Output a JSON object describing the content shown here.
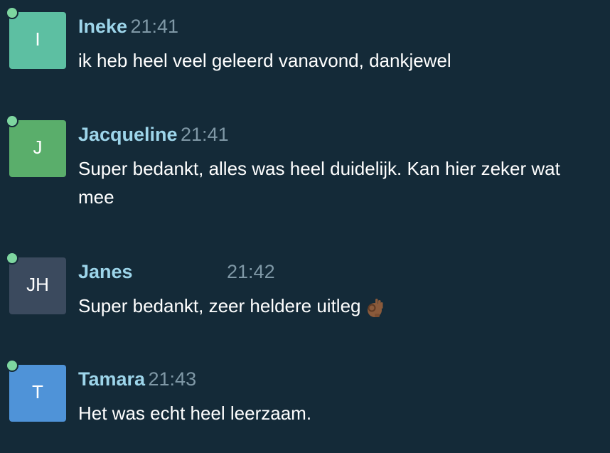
{
  "messages": [
    {
      "sender": "Ineke",
      "time": "21:41",
      "initials": "I",
      "avatar_color": "#5dbfa2",
      "text": "ik heb heel veel geleerd vanavond, dankjewel"
    },
    {
      "sender": "Jacqueline",
      "time": "21:41",
      "initials": "J",
      "avatar_color": "#5aae6b",
      "text": "Super bedankt, alles was heel duidelijk. Kan hier zeker wat mee"
    },
    {
      "sender": "Janes",
      "time": "21:42",
      "initials": "JH",
      "avatar_color": "#3b4a5e",
      "text": "Super bedankt, zeer heldere uitleg",
      "emoji": "ok-hand-icon"
    },
    {
      "sender": "Tamara",
      "time": "21:43",
      "initials": "T",
      "avatar_color": "#4f93d8",
      "text": "Het was echt heel leerzaam."
    }
  ],
  "presence_color": "#7ed6a0"
}
